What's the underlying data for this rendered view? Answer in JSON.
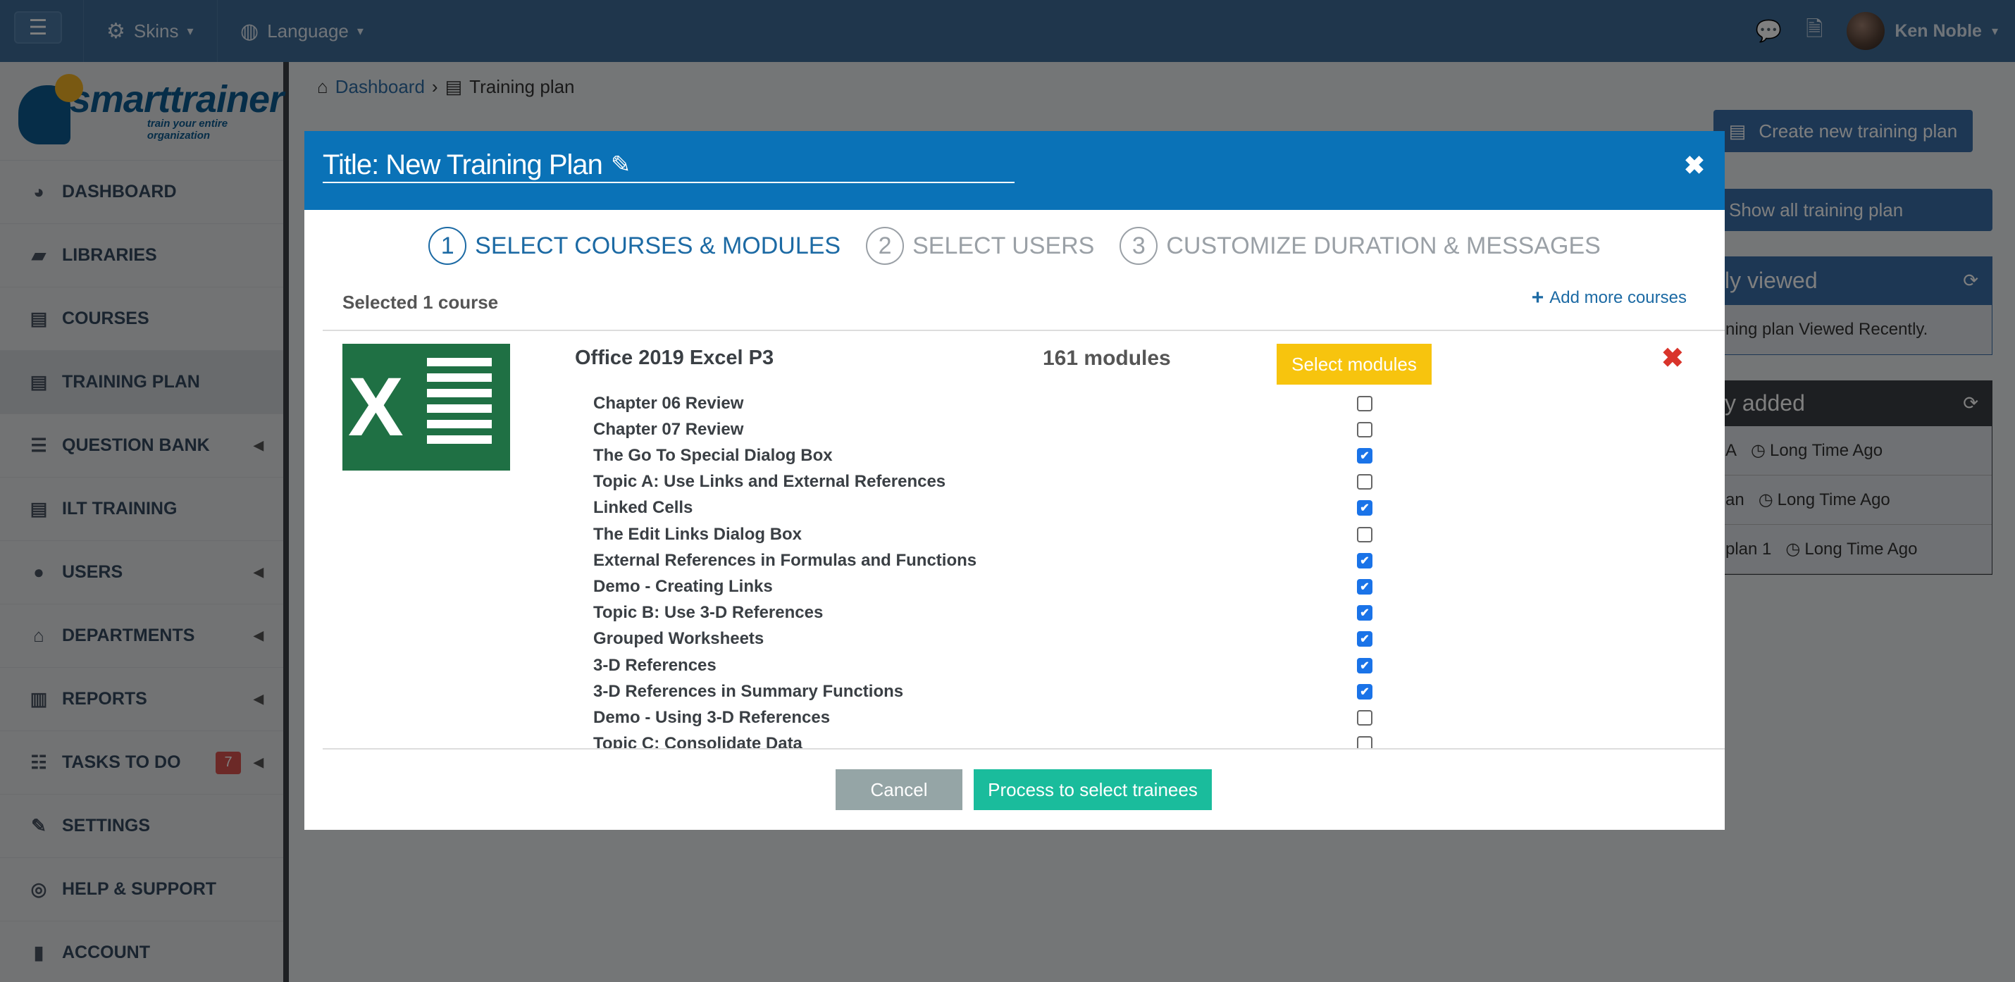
{
  "topbar": {
    "skins_label": "Skins",
    "language_label": "Language",
    "user_name": "Ken Noble"
  },
  "logo": {
    "title": "smarttrainer",
    "subtitle": "train your entire organization"
  },
  "sidebar": {
    "items": [
      {
        "label": "DASHBOARD",
        "icon": "dashboard-icon"
      },
      {
        "label": "LIBRARIES",
        "icon": "folder-icon"
      },
      {
        "label": "COURSES",
        "icon": "book-icon"
      },
      {
        "label": "TRAINING PLAN",
        "icon": "book-icon"
      },
      {
        "label": "QUESTION BANK",
        "icon": "list-icon"
      },
      {
        "label": "ILT TRAINING",
        "icon": "book-icon"
      },
      {
        "label": "USERS",
        "icon": "user-icon"
      },
      {
        "label": "DEPARTMENTS",
        "icon": "bank-icon"
      },
      {
        "label": "REPORTS",
        "icon": "bar-chart-icon"
      },
      {
        "label": "TASKS TO DO",
        "icon": "tasks-icon",
        "badge": "7"
      },
      {
        "label": "SETTINGS",
        "icon": "wrench-icon"
      },
      {
        "label": "HELP & SUPPORT",
        "icon": "life-ring-icon"
      },
      {
        "label": "ACCOUNT",
        "icon": "lock-icon"
      }
    ]
  },
  "breadcrumb": {
    "home": "Dashboard",
    "current": "Training plan"
  },
  "page": {
    "create_button": "Create new training plan",
    "show_all": "Show all training plan"
  },
  "right_panel": {
    "recently_viewed_title": "ly viewed",
    "recently_viewed_text": "ning plan Viewed Recently.",
    "recently_added_title": "y added",
    "recent_items": [
      {
        "name": "A",
        "time": "Long Time Ago"
      },
      {
        "name": "an",
        "time": "Long Time Ago"
      },
      {
        "name": "plan 1",
        "time": "Long Time Ago"
      }
    ]
  },
  "modal": {
    "title": "Title: New Training Plan",
    "steps": [
      {
        "num": "1",
        "label": "SELECT COURSES & MODULES"
      },
      {
        "num": "2",
        "label": "SELECT USERS"
      },
      {
        "num": "3",
        "label": "CUSTOMIZE DURATION & MESSAGES"
      }
    ],
    "selected_count": "Selected 1 course",
    "add_more": "Add more courses",
    "course": {
      "name": "Office 2019 Excel P3",
      "module_count": "161 modules",
      "select_modules": "Select modules"
    },
    "modules": [
      {
        "label": "Chapter 06 Review",
        "checked": false
      },
      {
        "label": "Chapter 07 Review",
        "checked": false
      },
      {
        "label": "The Go To Special Dialog Box",
        "checked": true
      },
      {
        "label": "Topic A: Use Links and External References",
        "checked": false
      },
      {
        "label": "Linked Cells",
        "checked": true
      },
      {
        "label": "The Edit Links Dialog Box",
        "checked": false
      },
      {
        "label": "External References in Formulas and Functions",
        "checked": true
      },
      {
        "label": "Demo - Creating Links",
        "checked": true
      },
      {
        "label": "Topic B: Use 3-D References",
        "checked": true
      },
      {
        "label": "Grouped Worksheets",
        "checked": true
      },
      {
        "label": "3-D References",
        "checked": true
      },
      {
        "label": "3-D References in Summary Functions",
        "checked": true
      },
      {
        "label": "Demo - Using 3-D References",
        "checked": false
      },
      {
        "label": "Topic C: Consolidate Data",
        "checked": false
      }
    ],
    "cancel": "Cancel",
    "process": "Process to select trainees"
  }
}
